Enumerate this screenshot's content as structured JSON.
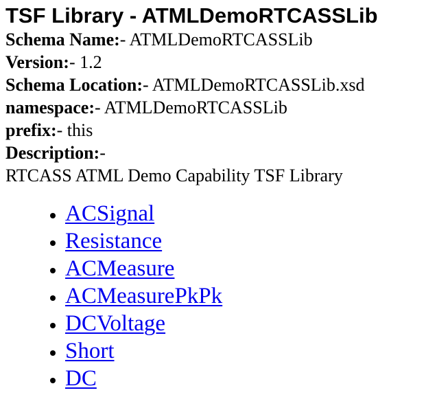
{
  "header": {
    "title": "TSF Library - ATMLDemoRTCASSLib"
  },
  "info": {
    "schema_name": {
      "label": "Schema Name:",
      "value": "- ATMLDemoRTCASSLib"
    },
    "version": {
      "label": "Version:",
      "value": "- 1.2"
    },
    "schema_location": {
      "label": "Schema Location:",
      "value": "- ATMLDemoRTCASSLib.xsd"
    },
    "namespace": {
      "label": "namespace:",
      "value": "- ATMLDemoRTCASSLib"
    },
    "prefix": {
      "label": "prefix:",
      "value": "- this"
    },
    "description": {
      "label": "Description:",
      "value": "-"
    },
    "description_text": "RTCASS ATML Demo Capability TSF Library"
  },
  "links": [
    {
      "label": "ACSignal"
    },
    {
      "label": "Resistance"
    },
    {
      "label": "ACMeasure"
    },
    {
      "label": "ACMeasurePkPk"
    },
    {
      "label": "DCVoltage"
    },
    {
      "label": "Short"
    },
    {
      "label": "DC"
    }
  ],
  "colors": {
    "link": "#0000ee",
    "text": "#000000",
    "background": "#ffffff"
  }
}
